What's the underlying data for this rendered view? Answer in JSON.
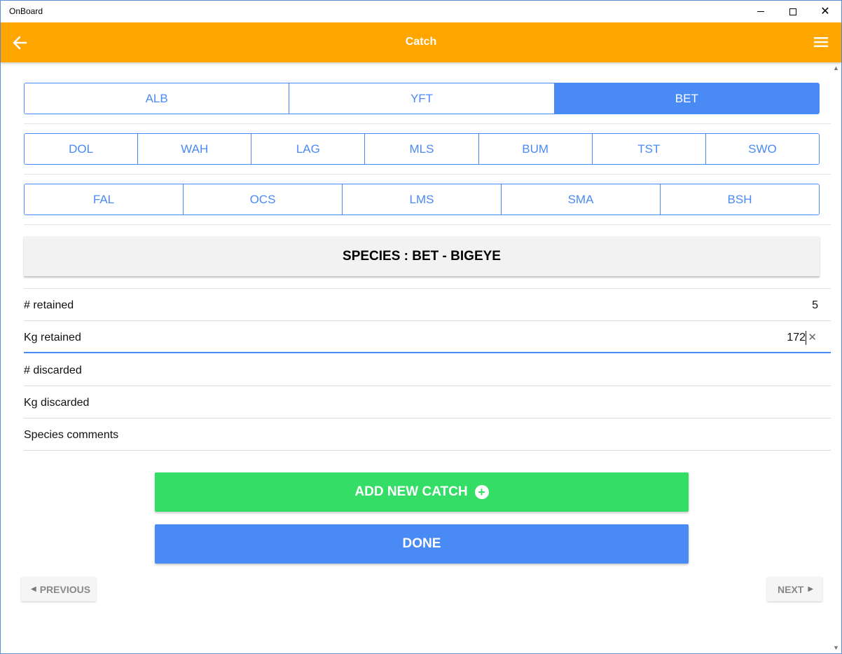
{
  "window": {
    "title": "OnBoard"
  },
  "header": {
    "title": "Catch",
    "back_icon": "arrow-left-icon",
    "menu_icon": "hamburger-menu-icon",
    "color": "#ffa500"
  },
  "species_rows": [
    {
      "items": [
        "ALB",
        "YFT",
        "BET"
      ]
    },
    {
      "items": [
        "DOL",
        "WAH",
        "LAG",
        "MLS",
        "BUM",
        "TST",
        "SWO"
      ]
    },
    {
      "items": [
        "FAL",
        "OCS",
        "LMS",
        "SMA",
        "BSH"
      ]
    }
  ],
  "selected_species": "BET",
  "species_banner": "SPECIES : BET - BIGEYE",
  "fields": {
    "retained_count": {
      "label": "# retained",
      "value": "5"
    },
    "retained_kg": {
      "label": "Kg retained",
      "value": "172"
    },
    "discarded_count": {
      "label": "# discarded",
      "value": ""
    },
    "discarded_kg": {
      "label": "Kg discarded",
      "value": ""
    },
    "comments": {
      "label": "Species comments",
      "value": ""
    }
  },
  "buttons": {
    "add_new_catch": "ADD NEW CATCH",
    "done": "DONE",
    "previous": "PREVIOUS",
    "next": "NEXT"
  },
  "colors": {
    "accent": "#4a8af4",
    "add": "#33dd66"
  }
}
